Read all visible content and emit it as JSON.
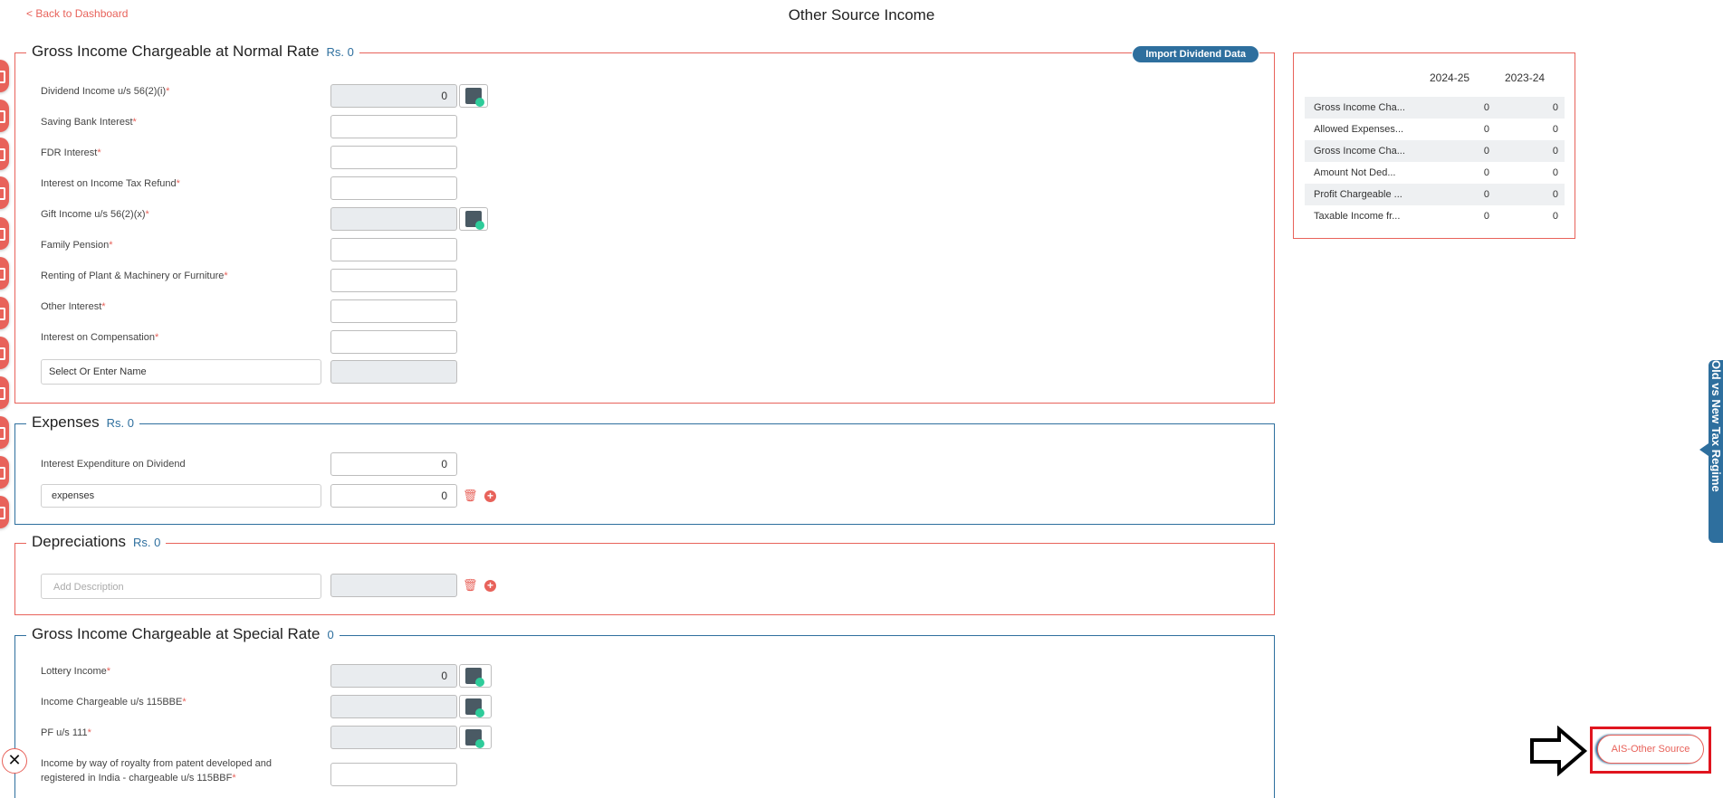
{
  "header": {
    "back_label": "< Back to Dashboard",
    "title": "Other Source Income"
  },
  "normal": {
    "title": "Gross Income Chargeable at Normal Rate",
    "amount": "Rs.  0",
    "import_label": "Import Dividend Data",
    "rows": [
      {
        "label": "Dividend Income u/s 56(2)(i)",
        "value": "0"
      },
      {
        "label": "Saving Bank Interest",
        "value": ""
      },
      {
        "label": "FDR Interest",
        "value": ""
      },
      {
        "label": "Interest on Income Tax Refund",
        "value": ""
      },
      {
        "label": "Gift Income u/s 56(2)(x)",
        "value": ""
      },
      {
        "label": "Family Pension",
        "value": ""
      },
      {
        "label": "Renting of Plant & Machinery or Furniture",
        "value": ""
      },
      {
        "label": "Other Interest",
        "value": ""
      },
      {
        "label": "Interest on Compensation",
        "value": ""
      }
    ],
    "select_placeholder": "Select Or Enter Name"
  },
  "expenses": {
    "title": "Expenses",
    "amount": "Rs.  0",
    "row_label": "Interest Expenditure on Dividend",
    "row_value": "0",
    "name_value": "expenses",
    "name_amount": "0"
  },
  "depreciations": {
    "title": "Depreciations",
    "amount": "Rs.  0",
    "placeholder": "Add Description"
  },
  "special": {
    "title": "Gross Income Chargeable at Special Rate",
    "amount": "0",
    "rows": [
      {
        "label": "Lottery Income",
        "value": "0"
      },
      {
        "label": "Income Chargeable u/s 115BBE",
        "value": ""
      },
      {
        "label": "PF u/s 111",
        "value": ""
      }
    ],
    "royalty_line1": "Income by way of royalty from patent developed and",
    "royalty_line2": "registered in India - chargeable u/s 115BBF"
  },
  "summary": {
    "years": [
      "2024-25",
      "2023-24"
    ],
    "rows": [
      {
        "label": "Gross Income Cha...",
        "v1": "0",
        "v2": "0"
      },
      {
        "label": "Allowed Expenses...",
        "v1": "0",
        "v2": "0"
      },
      {
        "label": "Gross Income Cha...",
        "v1": "0",
        "v2": "0"
      },
      {
        "label": "Amount Not Ded...",
        "v1": "0",
        "v2": "0"
      },
      {
        "label": "Profit Chargeable ...",
        "v1": "0",
        "v2": "0"
      },
      {
        "label": "Taxable Income fr...",
        "v1": "0",
        "v2": "0"
      }
    ]
  },
  "side_tab": "Old vs New Tax Regime",
  "ais_label": "AIS-Other Source",
  "close_glyph": "✕",
  "required_mark": "*",
  "colors": {
    "accent": "#e8625a",
    "blue": "#2e6f9e",
    "highlight": "#e0151f"
  }
}
